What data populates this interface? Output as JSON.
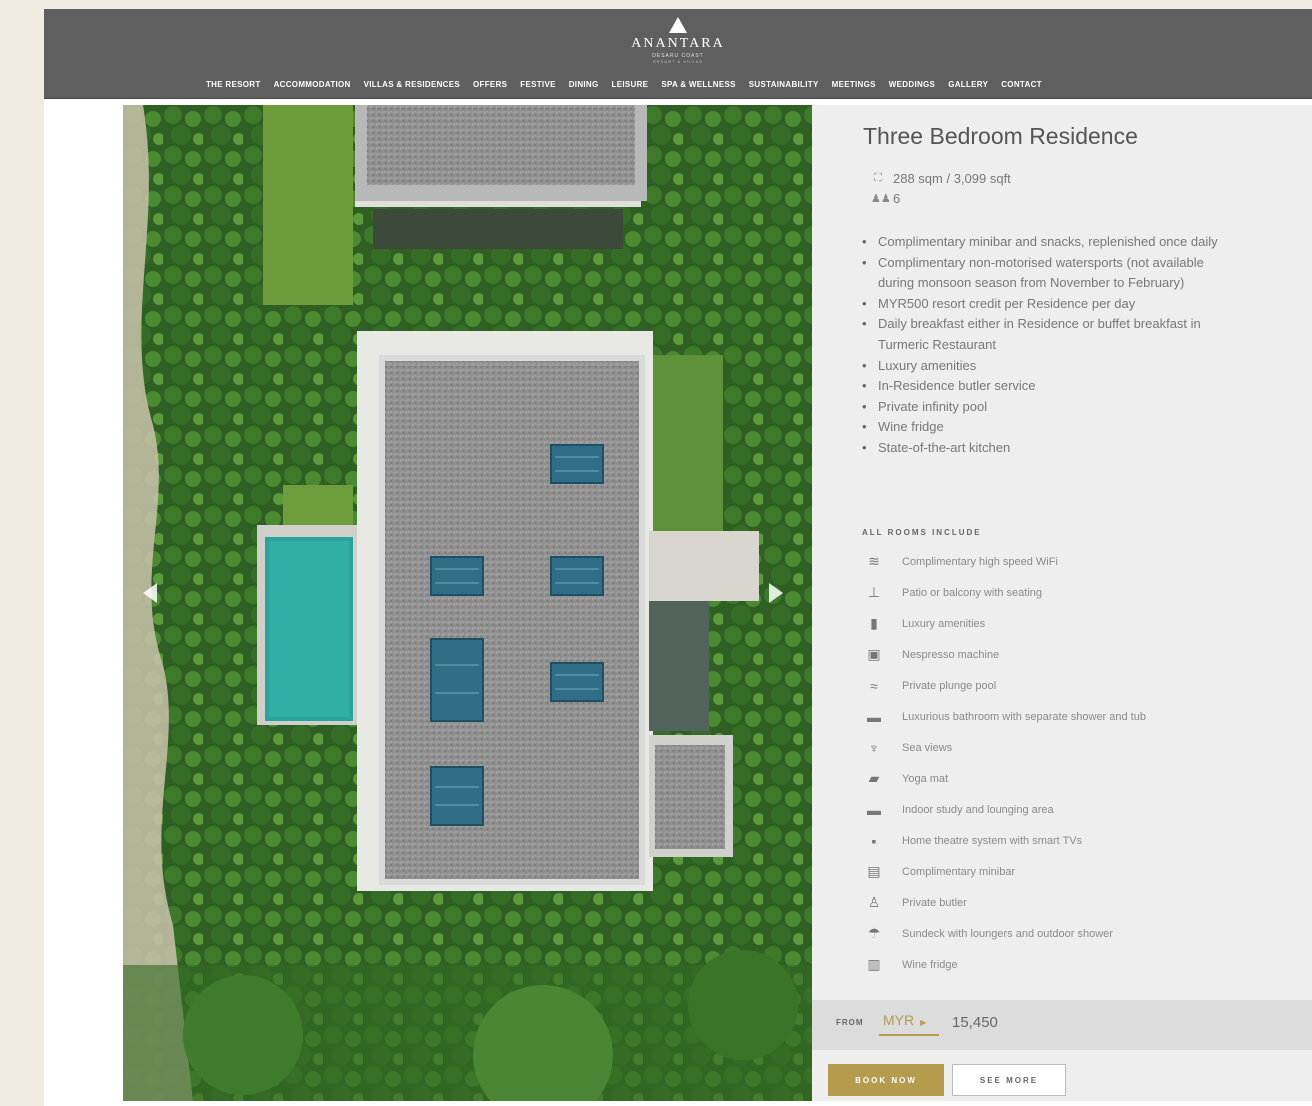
{
  "brand": {
    "name": "ANANTARA",
    "subline": "DESARU COAST",
    "subline2": "RESORT & VILLAS"
  },
  "nav": [
    "THE RESORT",
    "ACCOMMODATION",
    "VILLAS & RESIDENCES",
    "OFFERS",
    "FESTIVE",
    "DINING",
    "LEISURE",
    "SPA & WELLNESS",
    "SUSTAINABILITY",
    "MEETINGS",
    "WEDDINGS",
    "GALLERY",
    "CONTACT"
  ],
  "room": {
    "title": "Three Bedroom Residence",
    "size": "288 sqm / 3,099 sqft",
    "guests": "6",
    "size_icon": "floor-area-icon",
    "guests_icon": "guests-icon"
  },
  "features": [
    "Complimentary minibar and snacks, replenished once daily",
    "Complimentary non-motorised watersports (not available during monsoon season from November to February)",
    "MYR500 resort credit per Residence per day",
    "Daily breakfast either in Residence or buffet breakfast in Turmeric Restaurant",
    "Luxury amenities",
    "In-Residence butler service",
    "Private infinity pool",
    "Wine fridge",
    "State-of-the-art kitchen"
  ],
  "all_rooms_heading": "ALL ROOMS INCLUDE",
  "amenities": [
    {
      "icon": "wifi-icon",
      "glyph": "≋",
      "label": "Complimentary high speed WiFi"
    },
    {
      "icon": "patio-icon",
      "glyph": "⊥",
      "label": "Patio or balcony with seating"
    },
    {
      "icon": "amenities-icon",
      "glyph": "▮",
      "label": "Luxury amenities"
    },
    {
      "icon": "coffee-machine-icon",
      "glyph": "▣",
      "label": "Nespresso machine"
    },
    {
      "icon": "pool-icon",
      "glyph": "≈",
      "label": "Private plunge pool"
    },
    {
      "icon": "bathtub-icon",
      "glyph": "▬",
      "label": "Luxurious bathroom with separate shower and tub"
    },
    {
      "icon": "sea-view-icon",
      "glyph": "♆",
      "label": "Sea views"
    },
    {
      "icon": "yoga-mat-icon",
      "glyph": "▰",
      "label": "Yoga mat"
    },
    {
      "icon": "lounge-icon",
      "glyph": "▬",
      "label": "Indoor study and lounging area"
    },
    {
      "icon": "tv-icon",
      "glyph": "▪",
      "label": "Home theatre system with smart TVs"
    },
    {
      "icon": "minibar-icon",
      "glyph": "▤",
      "label": "Complimentary minibar"
    },
    {
      "icon": "butler-icon",
      "glyph": "♙",
      "label": "Private butler"
    },
    {
      "icon": "sundeck-icon",
      "glyph": "☂",
      "label": "Sundeck with loungers and outdoor shower"
    },
    {
      "icon": "wine-fridge-icon",
      "glyph": "▥",
      "label": "Wine fridge"
    }
  ],
  "pricing": {
    "from_label": "FROM",
    "currency": "MYR",
    "amount": "15,450"
  },
  "buttons": {
    "book": "BOOK NOW",
    "more": "SEE MORE"
  }
}
